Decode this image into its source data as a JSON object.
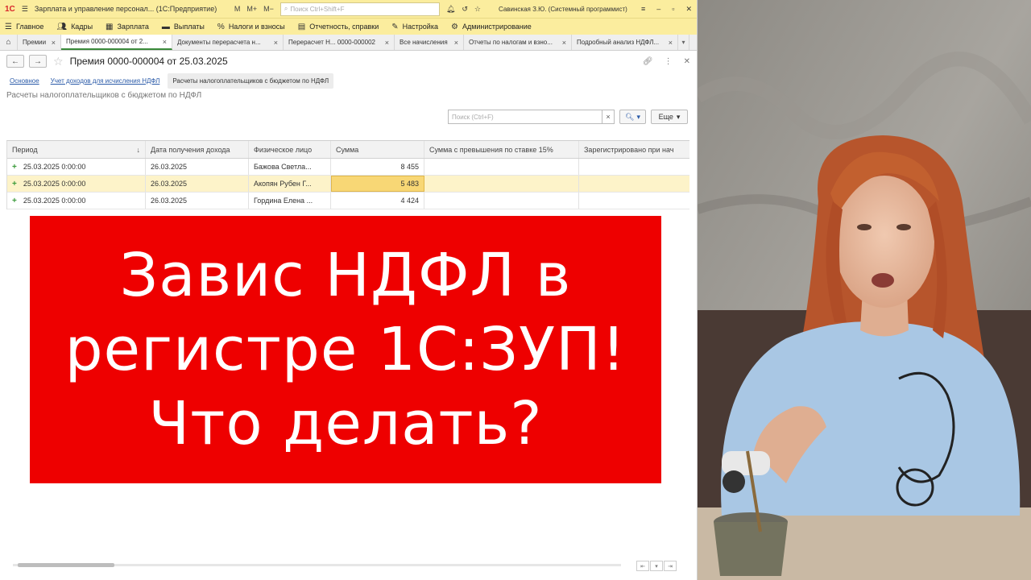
{
  "titlebar": {
    "logo": "1С",
    "title": "Зарплата и управление персонал... (1С:Предприятие)",
    "m": "M",
    "m_plus": "M+",
    "m_minus": "M−",
    "search_placeholder": "Поиск Ctrl+Shift+F",
    "user": "Савинская З.Ю. (Системный программист)"
  },
  "menu": [
    "Главное",
    "Кадры",
    "Зарплата",
    "Выплаты",
    "Налоги и взносы",
    "Отчетность, справки",
    "Настройка",
    "Администрирование"
  ],
  "tabs": [
    {
      "label": "Премии",
      "active": false
    },
    {
      "label": "Премия 0000-000004 от 2...",
      "active": true
    },
    {
      "label": "Документы перерасчета н...",
      "active": false
    },
    {
      "label": "Перерасчет Н... 0000-000002",
      "active": false
    },
    {
      "label": "Все начисления",
      "active": false
    },
    {
      "label": "Отчеты по налогам и взно...",
      "active": false
    },
    {
      "label": "Подробный анализ НДФЛ...",
      "active": false
    }
  ],
  "document": {
    "title": "Премия 0000-000004 от 25.03.2025",
    "subnav": {
      "basic": "Основное",
      "income": "Учет доходов для исчисления НДФЛ",
      "current": "Расчеты налогоплательщиков с бюджетом по НДФЛ"
    },
    "section_title": "Расчеты налогоплательщиков с бюджетом по НДФЛ",
    "search_placeholder": "Поиск (Ctrl+F)",
    "more_label": "Еще"
  },
  "table": {
    "columns": [
      "Период",
      "Дата получения дохода",
      "Физическое лицо",
      "Сумма",
      "Сумма с превышения по ставке 15%",
      "Зарегистрировано при нач"
    ],
    "rows": [
      {
        "period": "25.03.2025 0:00:00",
        "date": "26.03.2025",
        "person": "Бажова Светла...",
        "sum": "8 455"
      },
      {
        "period": "25.03.2025 0:00:00",
        "date": "26.03.2025",
        "person": "Акопян Рубен Г...",
        "sum": "5 483"
      },
      {
        "period": "25.03.2025 0:00:00",
        "date": "26.03.2025",
        "person": "Гордина Елена ...",
        "sum": "4 424"
      }
    ],
    "selected_row": 1
  },
  "banner": {
    "line1": "Завис НДФЛ в",
    "line2": "регистре 1С:ЗУП!",
    "line3": "Что делать?"
  },
  "colors": {
    "banner": "#ee0000",
    "titlebar": "#fbed9e",
    "selected_row": "#fdf3c9",
    "active_cell": "#f8d775",
    "add_icon": "#3a9a3a"
  }
}
